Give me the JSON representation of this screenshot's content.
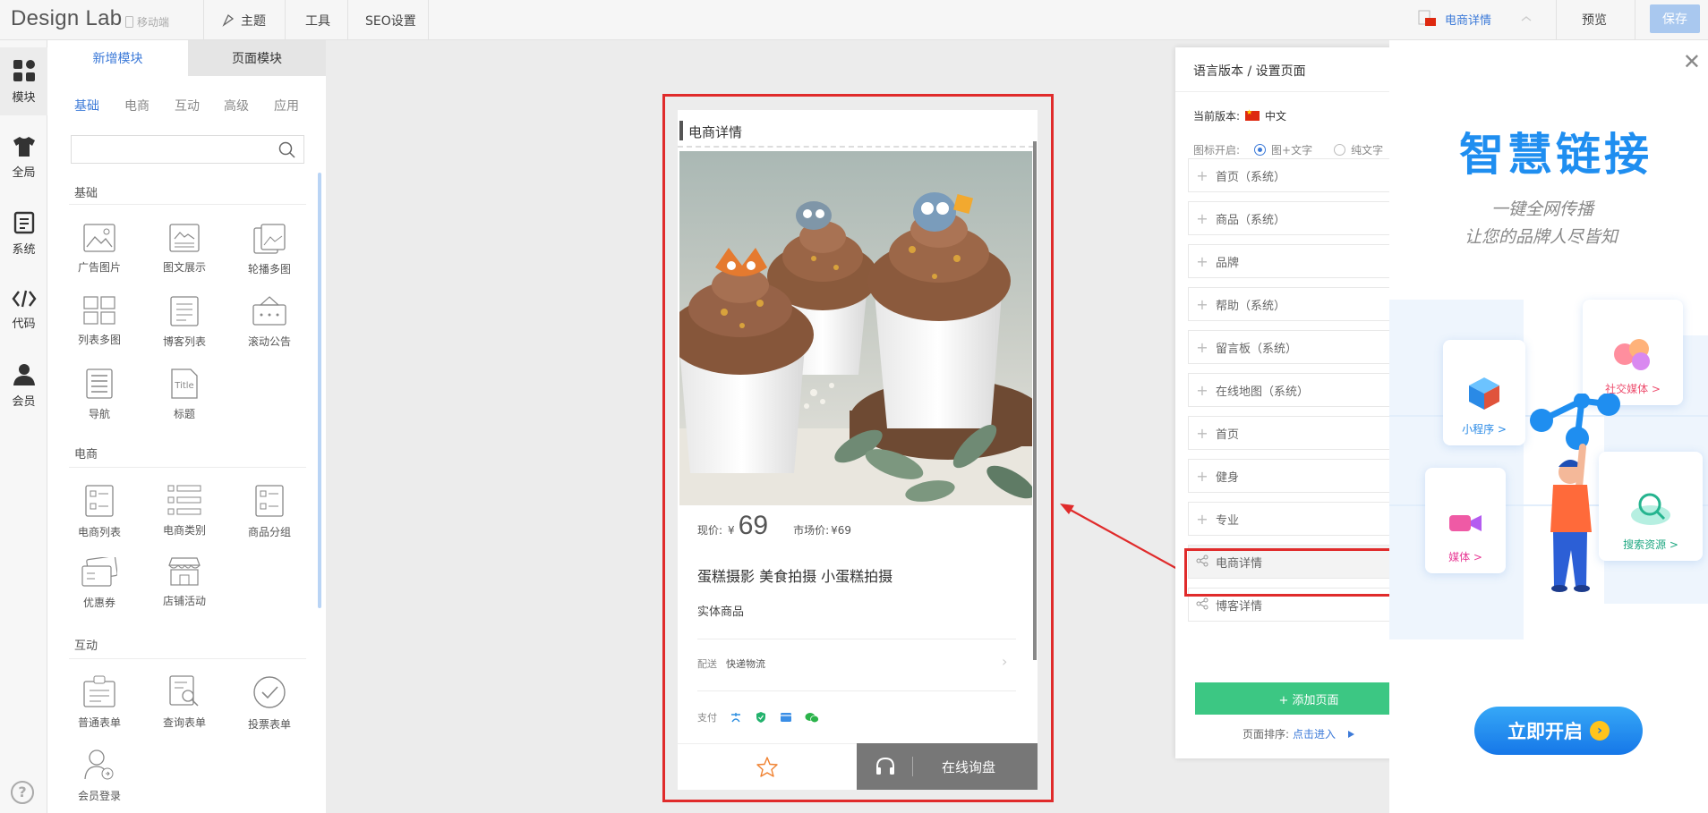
{
  "topbar": {
    "logo": "Design Lab",
    "mobile_tag": "移动端",
    "nav": [
      "主题",
      "工具",
      "SEO设置"
    ],
    "current_page": "电商详情",
    "preview": "预览",
    "save": "保存"
  },
  "rail": [
    {
      "label": "模块",
      "icon": "grid-icon"
    },
    {
      "label": "全局",
      "icon": "shirt-icon"
    },
    {
      "label": "系统",
      "icon": "document-icon"
    },
    {
      "label": "代码",
      "icon": "code-icon"
    },
    {
      "label": "会员",
      "icon": "user-icon"
    }
  ],
  "module_panel": {
    "tabs": [
      "新增模块",
      "页面模块"
    ],
    "categories": [
      "基础",
      "电商",
      "互动",
      "高级",
      "应用"
    ],
    "search_placeholder": "",
    "sections": [
      {
        "title": "基础",
        "items": [
          "广告图片",
          "图文展示",
          "轮播多图",
          "列表多图",
          "博客列表",
          "滚动公告",
          "导航",
          "标题"
        ]
      },
      {
        "title": "电商",
        "items": [
          "电商列表",
          "电商类别",
          "商品分组",
          "优惠券",
          "店铺活动"
        ]
      },
      {
        "title": "互动",
        "items": [
          "普通表单",
          "查询表单",
          "投票表单",
          "会员登录"
        ]
      }
    ]
  },
  "phone": {
    "title": "电商详情",
    "price_label": "现价:",
    "currency": "¥",
    "price": "69",
    "market_label": "市场价:",
    "market_price": "¥69",
    "product_name": "蛋糕摄影 美食拍摄 小蛋糕拍摄",
    "product_type": "实体商品",
    "shipping_label": "配送",
    "shipping_value": "快递物流",
    "pay_label": "支付",
    "consult": "在线询盘"
  },
  "settings": {
    "title": "语言版本 / 设置页面",
    "current_version_label": "当前版本:",
    "current_version": "中文",
    "icon_mode_label": "图标开启:",
    "icon_mode_options": [
      "图+文字",
      "纯文字"
    ],
    "pages": [
      {
        "label": "首页（系统）",
        "icon": "plus",
        "hidden": false
      },
      {
        "label": "商品（系统）",
        "icon": "plus",
        "hidden": false
      },
      {
        "label": "品牌",
        "icon": "plus",
        "hidden": false
      },
      {
        "label": "帮助（系统）",
        "icon": "plus",
        "hidden": false
      },
      {
        "label": "留言板（系统）",
        "icon": "plus",
        "hidden": true
      },
      {
        "label": "在线地图（系统）",
        "icon": "plus",
        "hidden": true
      },
      {
        "label": "首页",
        "icon": "plus",
        "hidden": false
      },
      {
        "label": "健身",
        "icon": "plus",
        "hidden": false
      },
      {
        "label": "专业",
        "icon": "plus",
        "hidden": false
      },
      {
        "label": "电商详情",
        "icon": "share",
        "hidden": false
      },
      {
        "label": "博客详情",
        "icon": "share",
        "hidden": false
      }
    ],
    "add_page": "+ 添加页面",
    "sort_label": "页面排序:",
    "sort_link": "点击进入"
  },
  "ad": {
    "title": "智慧链接",
    "sub1": "一键全网传播",
    "sub2": "让您的品牌人尽皆知",
    "cards": [
      "社交媒体 >",
      "小程序 >",
      "媒体 >",
      "搜索资源 >"
    ],
    "button": "立即开启"
  },
  "colors": {
    "accent": "#3c7ad8",
    "highlight": "#e02b2b",
    "green": "#3cc783",
    "ad_blue": "#1f8ef0"
  }
}
